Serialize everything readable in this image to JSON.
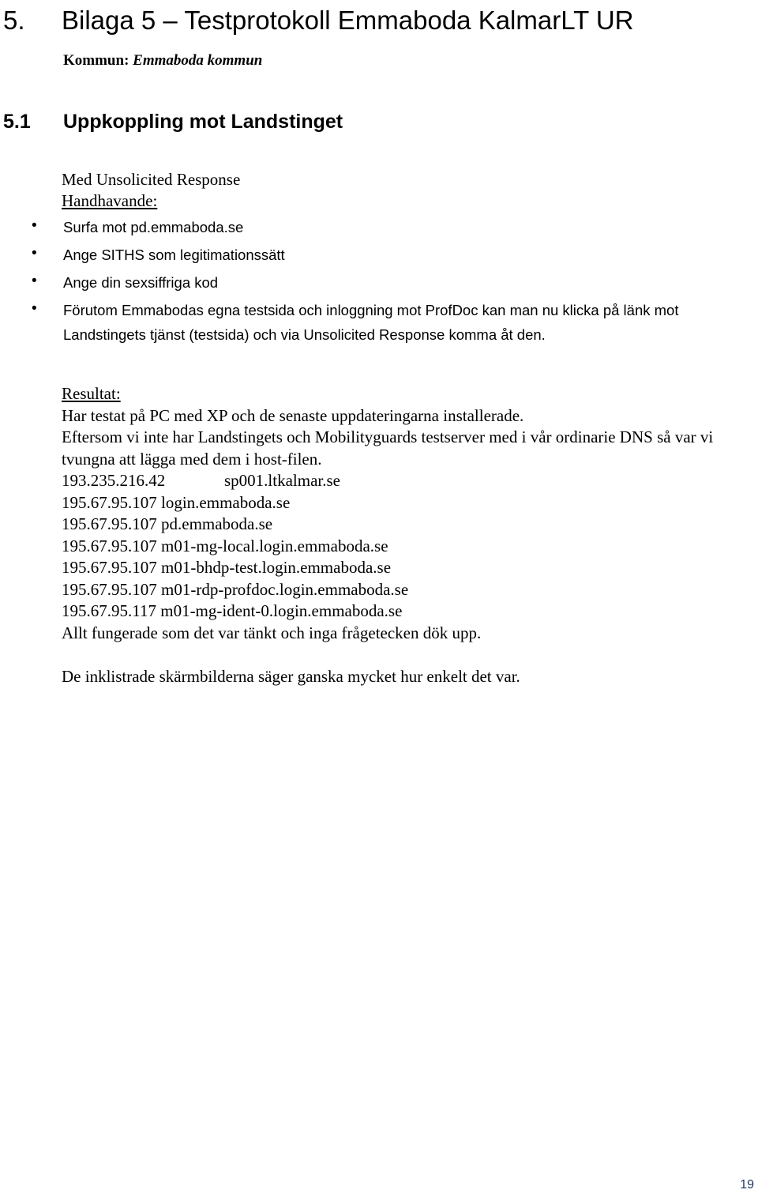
{
  "document": {
    "title_number": "5.",
    "title_text": "Bilaga 5 – Testprotokoll Emmaboda KalmarLT UR",
    "kommun_label": "Kommun:",
    "kommun_value": "Emmaboda kommun",
    "page_number": "19",
    "page_number_color": "#1f3864"
  },
  "section": {
    "number": "5.1",
    "heading": "Uppkoppling mot Landstinget",
    "intro_line_1": "Med Unsolicited Response",
    "intro_line_2": "Handhavande:"
  },
  "bullets": [
    "Surfa mot pd.emmaboda.se",
    "Ange SITHS som legitimationssätt",
    "Ange din sexsiffriga kod",
    "Förutom Emmabodas egna testsida och inloggning mot ProfDoc kan man nu klicka på länk mot Landstingets tjänst (testsida) och via Unsolicited Response komma åt den."
  ],
  "result": {
    "heading": "Resultat:",
    "paragraph_1": "Har testat på PC med XP och de senaste uppdateringarna installerade.",
    "paragraph_2": "Eftersom vi inte har Landstingets och Mobilityguards testserver med i vår ordinarie DNS så var vi tvungna att lägga med dem i host-filen.",
    "hosts": [
      {
        "ip": "193.235.216.42",
        "hostname": "sp001.ltkalmar.se",
        "tabbed": true
      },
      {
        "ip": "195.67.95.107",
        "hostname": "login.emmaboda.se",
        "tabbed": false
      },
      {
        "ip": "195.67.95.107",
        "hostname": "pd.emmaboda.se",
        "tabbed": false
      },
      {
        "ip": "195.67.95.107",
        "hostname": "m01-mg-local.login.emmaboda.se",
        "tabbed": false
      },
      {
        "ip": "195.67.95.107",
        "hostname": "m01-bhdp-test.login.emmaboda.se",
        "tabbed": false
      },
      {
        "ip": "195.67.95.107",
        "hostname": "m01-rdp-profdoc.login.emmaboda.se",
        "tabbed": false
      },
      {
        "ip": "195.67.95.117",
        "hostname": "m01-mg-ident-0.login.emmaboda.se",
        "tabbed": false
      }
    ],
    "closing_line": "Allt fungerade som det var tänkt och inga frågetecken dök upp.",
    "footnote": "De inklistrade skärmbilderna säger ganska mycket hur enkelt det var."
  }
}
